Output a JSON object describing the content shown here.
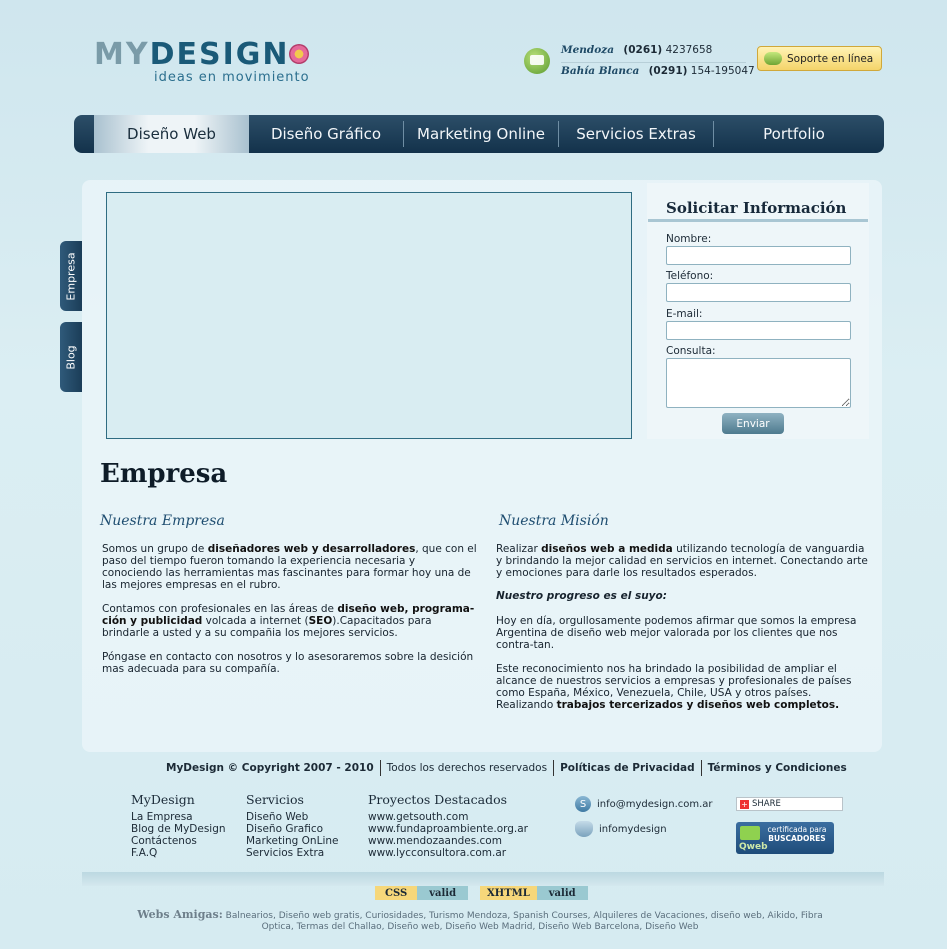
{
  "header": {
    "logo_my": "MY",
    "logo_design": "DESIGN",
    "logo_tagline": "ideas en movimiento",
    "contacts": [
      {
        "city": "Mendoza",
        "area": "(0261)",
        "number": "4237658"
      },
      {
        "city": "Bahía Blanca",
        "area": "(0291)",
        "number": "154-195047"
      }
    ],
    "support_label": "Soporte en línea"
  },
  "nav": {
    "items": [
      {
        "label": "Diseño Web",
        "active": true
      },
      {
        "label": "Diseño Gráfico",
        "active": false
      },
      {
        "label": "Marketing Online",
        "active": false
      },
      {
        "label": "Servicios Extras",
        "active": false
      },
      {
        "label": "Portfolio",
        "active": false
      }
    ]
  },
  "side_tabs": [
    "Empresa",
    "Blog"
  ],
  "form": {
    "title": "Solicitar Información",
    "name_label": "Nombre:",
    "phone_label": "Teléfono:",
    "email_label": "E-mail:",
    "query_label": "Consulta:",
    "name_value": "",
    "phone_value": "",
    "email_value": "",
    "query_value": "",
    "submit_label": "Enviar"
  },
  "content": {
    "page_title": "Empresa",
    "left_title": "Nuestra Empresa",
    "right_title": "Nuestra Misión",
    "left_p1_a": "Somos un grupo de ",
    "left_p1_b": "diseñadores web y desarrolladores",
    "left_p1_c": ", que con el paso del tiempo fueron tomando la experiencia necesaria y conociendo las herramientas mas fascinantes para formar hoy una de las mejores empresas en el rubro.",
    "left_p2_a": "Contamos con profesionales en las áreas de ",
    "left_p2_b": "diseño web, programa-ción y publicidad",
    "left_p2_c": " volcada a internet (",
    "left_p2_d": "SEO",
    "left_p2_e": ").Capacitados para brindarle a usted y a su compañia los mejores servicios.",
    "left_p3": "Póngase en contacto con nosotros y lo asesoraremos sobre la desición mas adecuada para su compañía.",
    "right_p1_a": "Realizar ",
    "right_p1_b": "diseños web a medida",
    "right_p1_c": " utilizando tecnología de vanguardia y brindando la mejor calidad en servicios en internet. Conectando arte y emociones para darle los resultados esperados.",
    "right_p2": "Nuestro progreso es el suyo:",
    "right_p3": "Hoy en día, orgullosamente podemos afirmar que somos la empresa Argentina de diseño web mejor valorada por los clientes que nos contra-tan.",
    "right_p4_a": "Este reconocimiento nos ha brindado la posibilidad de ampliar el alcance de nuestros servicios a empresas y profesionales de países como España, México, Venezuela, Chile, USA y otros países. Realizando ",
    "right_p4_b": "trabajos tercerizados y diseños web completos."
  },
  "footer": {
    "copyright": "MyDesign © Copyright 2007 - 2010",
    "rights": "Todos los derechos reservados",
    "privacy": "Políticas de Privacidad",
    "terms": "Términos y Condiciones",
    "columns": [
      {
        "title": "MyDesign",
        "items": [
          "La Empresa",
          "Blog de MyDesign",
          "Contáctenos",
          "F.A.Q"
        ]
      },
      {
        "title": "Servicios",
        "items": [
          "Diseño Web",
          "Diseño Grafico",
          "Marketing OnLine",
          "Servicios Extra"
        ]
      },
      {
        "title": "Proyectos Destacados",
        "items": [
          "www.getsouth.com",
          "www.fundaproambiente.org.ar",
          "www.mendozaandes.com",
          "www.lycconsultora.com.ar"
        ]
      }
    ],
    "skype": "info@mydesign.com.ar",
    "messenger": "infomydesign",
    "share_label": "SHARE",
    "qweb_line1": "certificada para",
    "qweb_line2": "BUSCADORES",
    "qweb_brand": "Qweb",
    "badges": [
      {
        "key": "CSS",
        "val": "valid"
      },
      {
        "key": "XHTML",
        "val": "valid"
      }
    ],
    "friends_label": "Webs Amigas:",
    "friends_text": "Balnearios, Diseño web gratis, Curiosidades, Turismo Mendoza, Spanish Courses, Alquileres de Vacaciones, diseño web, Aikido, Fibra Optica, Termas del Challao, Diseño web, Diseño Web Madrid, Diseño Web Barcelona, Diseño Web"
  }
}
